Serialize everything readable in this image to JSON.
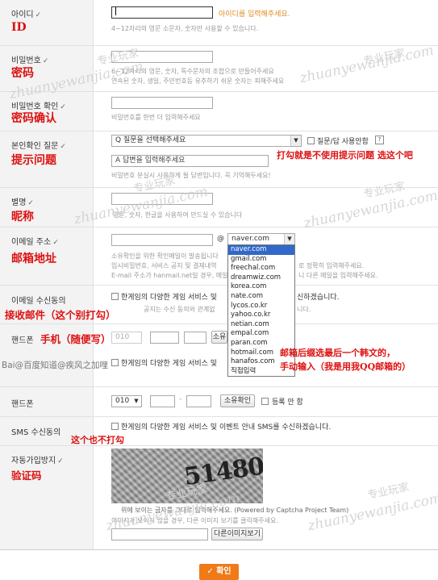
{
  "fields": {
    "id": {
      "label": "아이디",
      "cn": "ID",
      "msg": "아이디를 입력해주세요.",
      "hint": "4~12자리의 영문 소문자, 숫자만 사용할 수 있습니다."
    },
    "pw": {
      "label": "비밀번호",
      "cn": "密码",
      "hint1": "6~12자리의 영문, 숫자, 특수문자의 조합으로 만들어주세요",
      "hint2": "연속된 숫자, 생일, 주민번호등 유추하기 쉬운 숫자는 피해주세요"
    },
    "pw_confirm": {
      "label": "비밀번호 확인",
      "cn": "密码确认",
      "hint": "비밀번호를 한번 더 입력해주세요"
    },
    "question": {
      "label": "본인확인 질문",
      "cn": "提示问题",
      "select": "Q 질문을 선택해주세요",
      "checkbox_label": "질문/답 사용안함",
      "help": "?",
      "answer_placeholder": "A 답변을 입력해주세요",
      "hint": "비밀번호 분실시 사용하게 될 답변입니다. 꼭 기억해두세요!",
      "annotation": "打勾就是不使用提示问题 选这个吧"
    },
    "nickname": {
      "label": "별명",
      "cn": "昵称",
      "hint": "영문, 숫자, 한글을 사용하여 만드실 수 있습니다"
    },
    "email": {
      "label": "이메일 주소",
      "cn": "邮箱地址",
      "at": "@",
      "domain": "naver.com",
      "hint1": "소유확인을 위한 확인메일이 발송됩니다",
      "hint2": "임시비밀번호, 서비스 공지 및 결제내역",
      "hint2b": "로 정확히 입력해주세요.",
      "hint3": "E-mail 주소가 hanmail.net일 경우, 메일",
      "hint3b": "니 다른 메일을 입력해주세요.",
      "options": [
        "naver.com",
        "gmail.com",
        "freechal.com",
        "dreamwiz.com",
        "korea.com",
        "nate.com",
        "lycos.co.kr",
        "yahoo.co.kr",
        "netian.com",
        "empal.com",
        "paran.com",
        "hotmail.com",
        "hanafos.com",
        "직접입력"
      ],
      "annotation1": "邮箱后缀选最后一个韩文的，",
      "annotation2": "手动输入（我是用我QQ邮箱的）"
    },
    "email_agree": {
      "label": "이메일 수신동의",
      "cn": "接收邮件（这个别打勾）",
      "text": "한게임의 다양한 게임 서비스 및",
      "text_b": "신하겠습니다.",
      "text2": "공지는 수신 동의와 관계없",
      "text2_b": "니다."
    },
    "phone_old": {
      "label": "핸드폰",
      "cn": "手机（随便写）",
      "prefix": "010",
      "btn": "소유"
    },
    "overlap": {
      "baidu_text": "Bai@百度知道@疾风之加哩",
      "text": "한게임의 다양한 게임 서비스 및"
    },
    "phone": {
      "label": "핸드폰",
      "prefix": "010",
      "dash": "-",
      "btn": "소유확인",
      "nocheck": "등록 안 함"
    },
    "sms": {
      "label": "SMS 수신동의",
      "text": "한게임의 다양한 게임 서비스 및 이벤트 안내 SMS를 수신하겠습니다.",
      "annotation": "这个也不打勾"
    },
    "captcha": {
      "label": "자동가입방지",
      "cn": "验证码",
      "code": "514809",
      "hint1": "위에 보이는 글자를 그대로 입력해주세요. (Powered by Captcha Project Team)",
      "hint2": "이미지가 보이지 않을 경우, 다른 이미지 보기를 클릭해주세요.",
      "btn": "다른이미지보기"
    },
    "check_mark": "✓"
  },
  "watermark": {
    "pinyin": "zhuanyewanjia.com",
    "cn": "专业玩家"
  },
  "confirm_btn": "✓ 확인"
}
